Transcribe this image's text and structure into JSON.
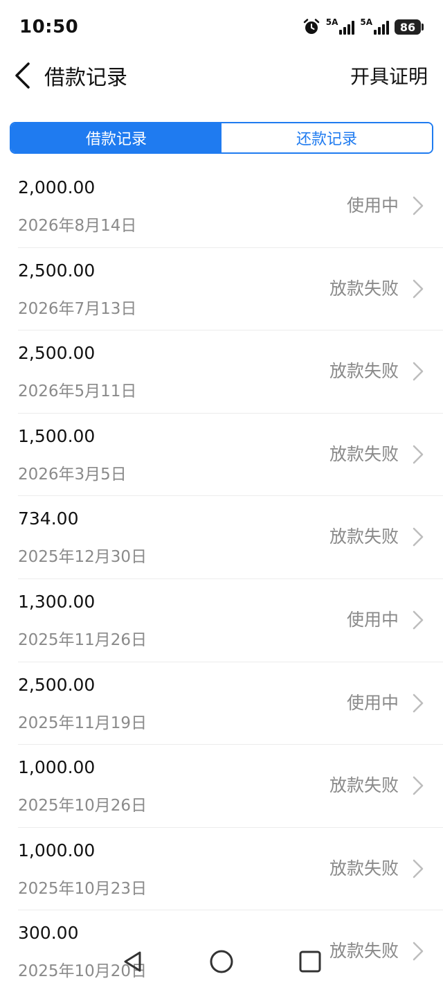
{
  "status_bar": {
    "time": "10:50",
    "network1": "5A",
    "network2": "5A",
    "battery": "86"
  },
  "header": {
    "title": "借款记录",
    "action": "开具证明"
  },
  "tabs": [
    {
      "label": "借款记录",
      "active": true
    },
    {
      "label": "还款记录",
      "active": false
    }
  ],
  "records": [
    {
      "amount": "2,000.00",
      "date": "2026年8月14日",
      "status": "使用中"
    },
    {
      "amount": "2,500.00",
      "date": "2026年7月13日",
      "status": "放款失败"
    },
    {
      "amount": "2,500.00",
      "date": "2026年5月11日",
      "status": "放款失败"
    },
    {
      "amount": "1,500.00",
      "date": "2026年3月5日",
      "status": "放款失败"
    },
    {
      "amount": "734.00",
      "date": "2025年12月30日",
      "status": "放款失败"
    },
    {
      "amount": "1,300.00",
      "date": "2025年11月26日",
      "status": "使用中"
    },
    {
      "amount": "2,500.00",
      "date": "2025年11月19日",
      "status": "使用中"
    },
    {
      "amount": "1,000.00",
      "date": "2025年10月26日",
      "status": "放款失败"
    },
    {
      "amount": "1,000.00",
      "date": "2025年10月23日",
      "status": "放款失败"
    },
    {
      "amount": "300.00",
      "date": "2025年10月20日",
      "status": "放款失败"
    }
  ],
  "colors": {
    "accent": "#1f7bf0",
    "muted_text": "#8a8a8a"
  },
  "icons": {
    "back": "chevron-left-icon",
    "row_arrow": "chevron-right-icon",
    "alarm": "alarm-icon",
    "nav_back": "triangle-back-icon",
    "nav_home": "circle-home-icon",
    "nav_recents": "square-recents-icon"
  }
}
